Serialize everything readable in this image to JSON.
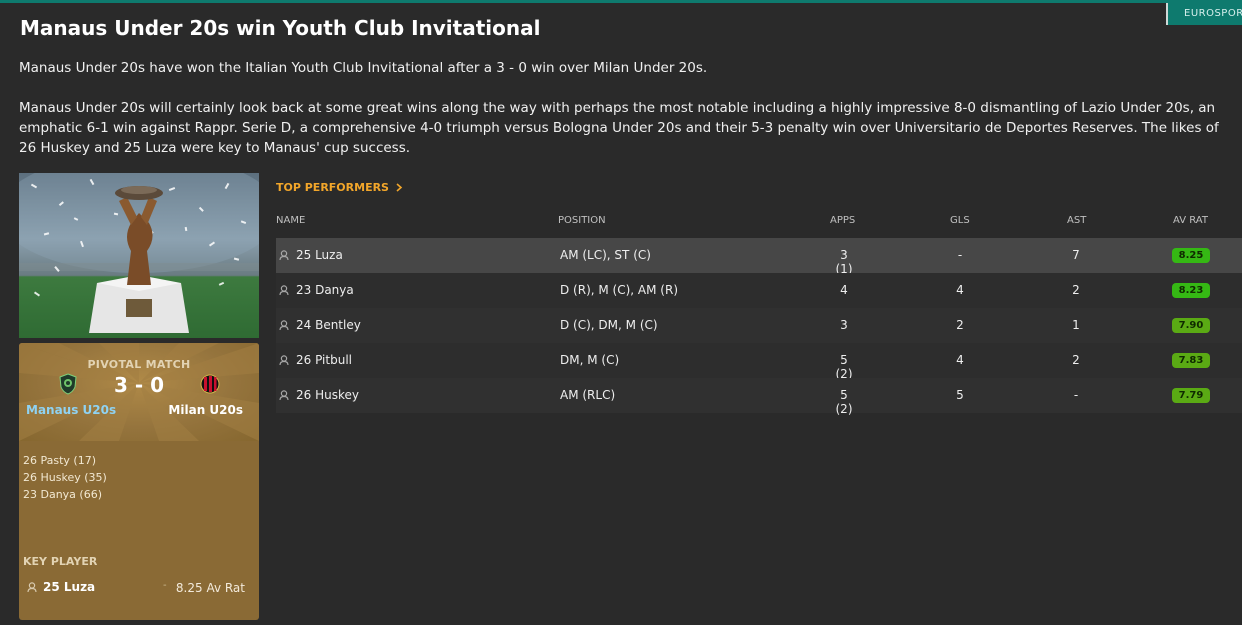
{
  "source": "EUROSPORT",
  "headline": "Manaus Under 20s win Youth Club Invitational",
  "paragraphs": [
    "Manaus Under 20s have won the Italian Youth Club Invitational after a 3 - 0 win over Milan Under 20s.",
    "Manaus Under 20s will certainly look back at some great wins along the way with perhaps the most notable including a highly impressive 8-0 dismantling of Lazio Under 20s, an emphatic 6-1 win against Rappr. Serie D, a comprehensive 4-0 triumph versus Bologna Under 20s and their 5-3 penalty win over Universitario de Deportes Reserves. The likes of 26 Huskey and 25 Luza were key to Manaus' cup success."
  ],
  "pivotal_match": {
    "label": "PIVOTAL MATCH",
    "score": "3 - 0",
    "home_team": "Manaus U20s",
    "away_team": "Milan U20s",
    "home_color": "#8fd2f2",
    "scorers": [
      "26 Pasty (17)",
      "26 Huskey (35)",
      "23 Danya (66)"
    ],
    "key_player_label": "KEY PLAYER",
    "key_player_name": "25 Luza",
    "key_player_sep": "-",
    "key_player_rating": "8.25 Av Rat"
  },
  "top_performers": {
    "link_label": "TOP PERFORMERS",
    "link_color": "#f2a62a",
    "columns": {
      "name": "NAME",
      "position": "POSITION",
      "apps": "APPS",
      "gls": "GLS",
      "ast": "AST",
      "av_rat": "AV RAT"
    },
    "rows": [
      {
        "name": "25 Luza",
        "position": "AM (LC), ST (C)",
        "apps": "3 (1)",
        "gls": "-",
        "ast": "7",
        "av_rat": "8.25",
        "badge_color": "#35b814"
      },
      {
        "name": "23 Danya",
        "position": "D (R), M (C), AM (R)",
        "apps": "4",
        "gls": "4",
        "ast": "2",
        "av_rat": "8.23",
        "badge_color": "#35b814"
      },
      {
        "name": "24 Bentley",
        "position": "D (C), DM, M (C)",
        "apps": "3",
        "gls": "2",
        "ast": "1",
        "av_rat": "7.90",
        "badge_color": "#5aaa14"
      },
      {
        "name": "26 Pitbull",
        "position": "DM, M (C)",
        "apps": "5 (2)",
        "gls": "4",
        "ast": "2",
        "av_rat": "7.83",
        "badge_color": "#5aaa14"
      },
      {
        "name": "26 Huskey",
        "position": "AM (RLC)",
        "apps": "5 (2)",
        "gls": "5",
        "ast": "-",
        "av_rat": "7.79",
        "badge_color": "#5aaa14"
      }
    ]
  },
  "icons": {
    "person": "person-icon",
    "chevron": "chevron-right-icon",
    "home_crest": "manaus-crest-icon",
    "away_crest": "milan-crest-icon"
  }
}
